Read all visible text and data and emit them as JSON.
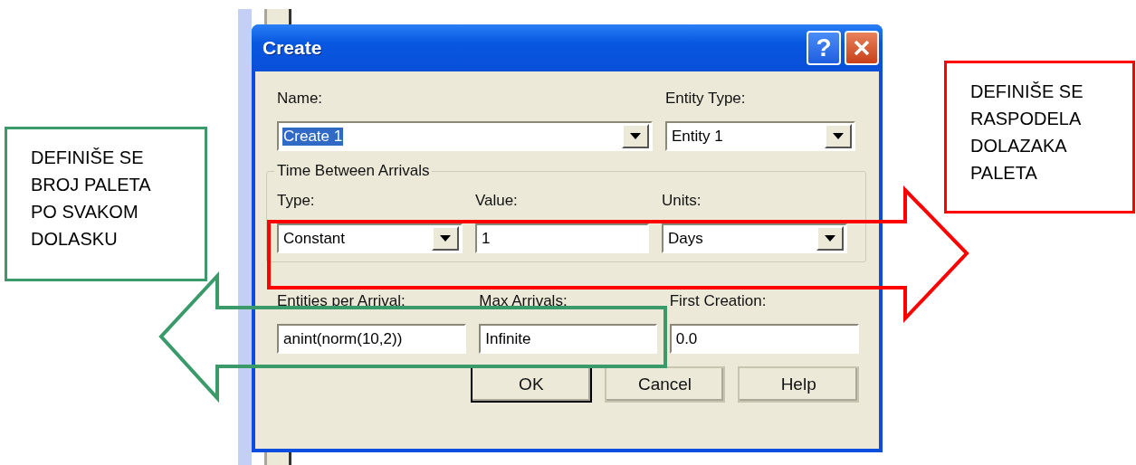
{
  "dialog": {
    "title": "Create",
    "help_button": "?",
    "name": {
      "label": "Name:",
      "value": "Create 1",
      "text_selected": true
    },
    "entity_type": {
      "label": "Entity Type:",
      "value": "Entity 1"
    },
    "group": {
      "title": "Time Between Arrivals",
      "fields": [
        {
          "label": "Type:",
          "value": "Constant",
          "kind": "combo"
        },
        {
          "label": "Value:",
          "value": "1",
          "kind": "text"
        },
        {
          "label": "Units:",
          "value": "Days",
          "kind": "combo"
        }
      ]
    },
    "fields": [
      {
        "label": "Entities per Arrival:",
        "value": "anint(norm(10,2))",
        "kind": "text"
      },
      {
        "label": "Max Arrivals:",
        "value": "Infinite",
        "kind": "text"
      },
      {
        "label": "First Creation:",
        "value": "0.0",
        "kind": "text"
      }
    ],
    "buttons": [
      {
        "label": "OK",
        "default": true
      },
      {
        "label": "Cancel",
        "default": false
      },
      {
        "label": "Help",
        "default": false
      }
    ]
  },
  "callouts": [
    {
      "text": "DEFINIŠE SE BROJ PALETA PO SVAKOM DOLASKU",
      "color": "#3a9a6a"
    },
    {
      "text": "DEFINIŠE SE RASPODELA DOLAZAKA PALETA",
      "color": "#ff0000"
    }
  ]
}
